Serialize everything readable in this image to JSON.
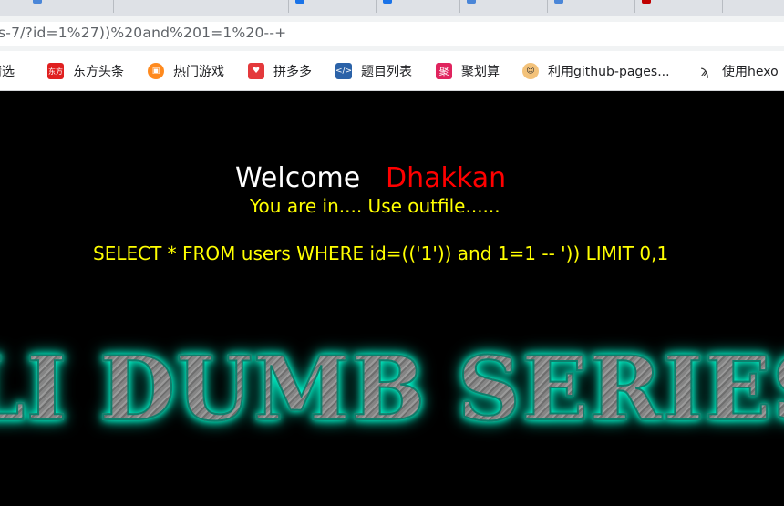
{
  "browser": {
    "address_bar": {
      "url": "s-7/?id=1%27))%20and%201=1%20--+"
    },
    "bookmarks": [
      {
        "label": "精选",
        "icon": "bookmark-icon"
      },
      {
        "label": "东方头条",
        "icon": "dongfang-icon",
        "icon_text": "东方"
      },
      {
        "label": "热门游戏",
        "icon": "game-icon"
      },
      {
        "label": "拼多多",
        "icon": "pinduoduo-icon"
      },
      {
        "label": "题目列表",
        "icon": "code-icon"
      },
      {
        "label": "聚划算",
        "icon": "juhuasuan-icon",
        "icon_text": "聚"
      },
      {
        "label": "利用github-pages...",
        "icon": "avatar-icon"
      },
      {
        "label": "使用hexo",
        "icon": "hexo-icon"
      }
    ]
  },
  "page": {
    "welcome": "Welcome",
    "username": "Dhakkan",
    "status_message": "You are in.... Use outfile......",
    "query": "SELECT * FROM users WHERE id=(('1')) and 1=1 -- ')) LIMIT 0,1",
    "banner_text": "LI DUMB SERIES"
  },
  "colors": {
    "page_background": "#000000",
    "welcome": "#ffffff",
    "username": "#ff0000",
    "message": "#ffff00",
    "banner_glow": "#00ffd0"
  }
}
